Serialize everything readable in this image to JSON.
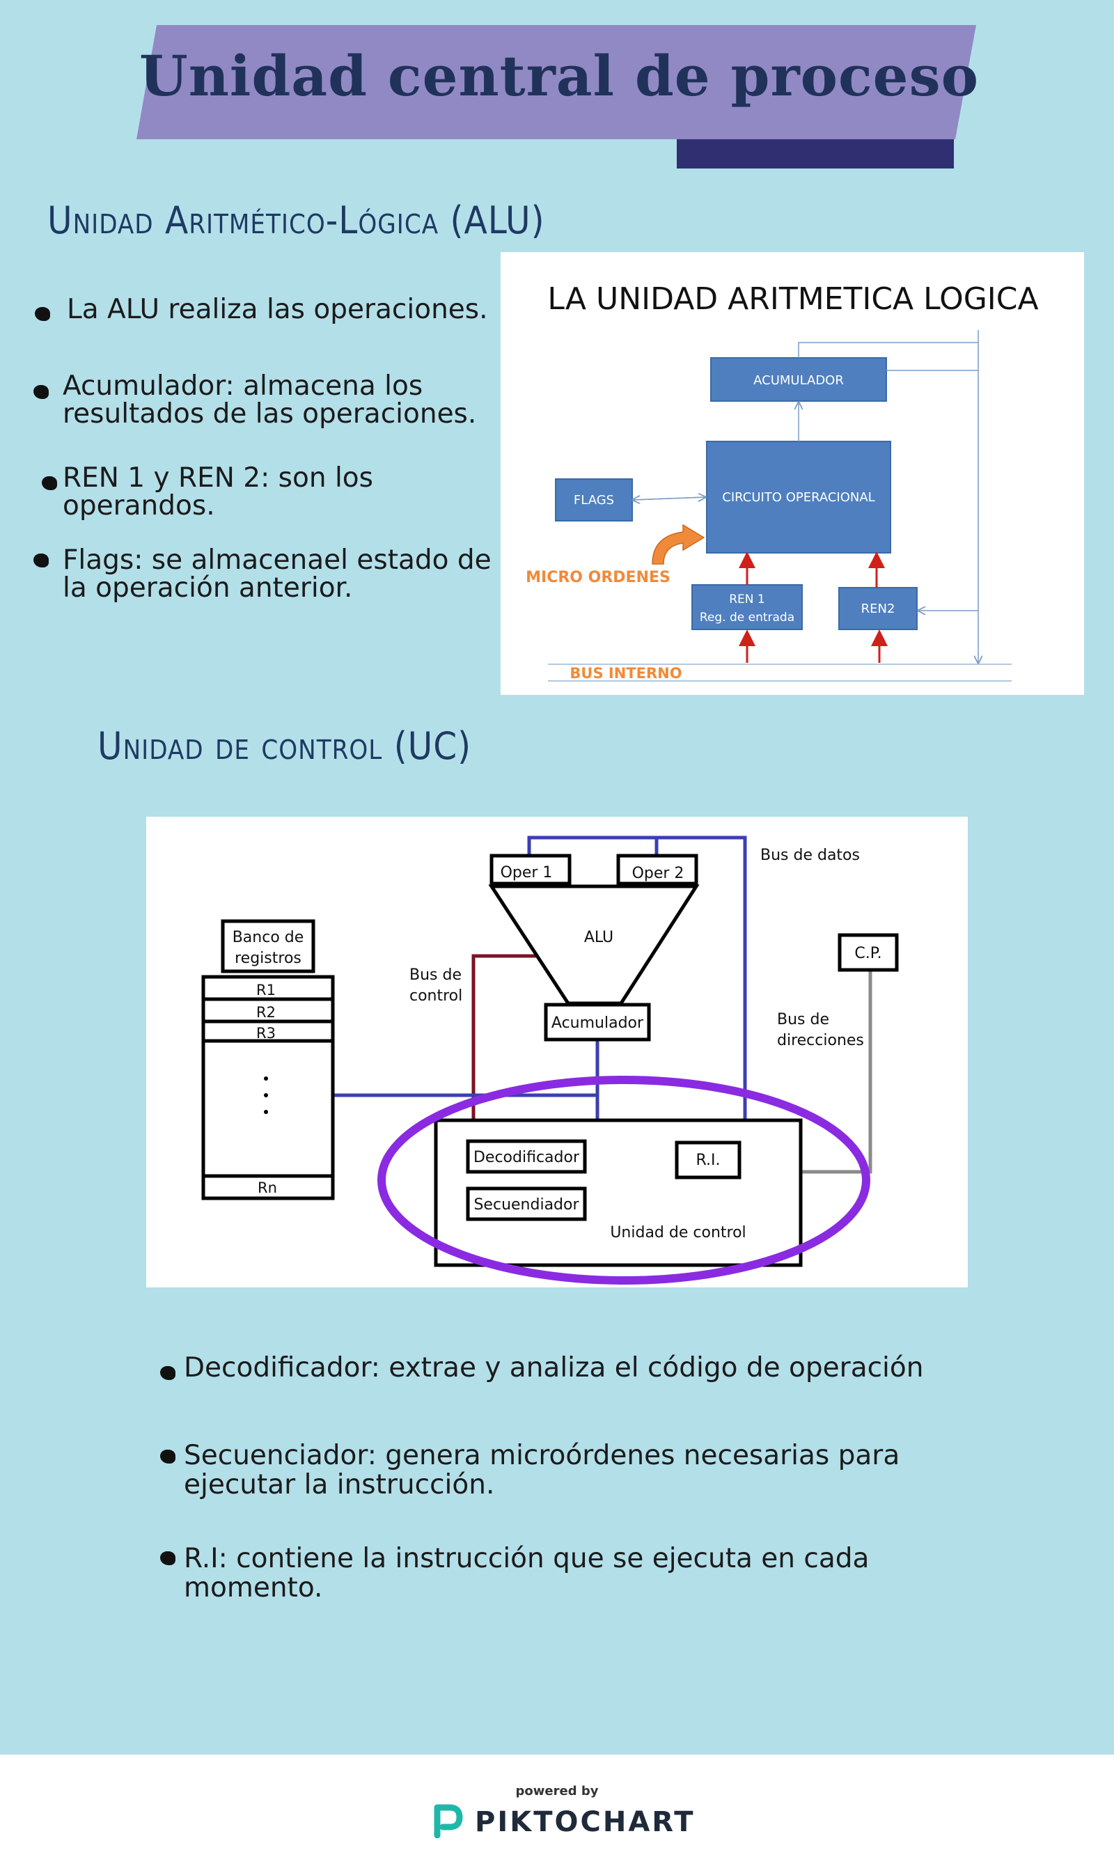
{
  "title": "Unidad central de proceso",
  "alu_section": {
    "heading": "Unidad Aritmético-Lógica (ALU)",
    "bullets": [
      "La ALU realiza las operaciones.",
      "Acumulador: almacena los",
      "resultados de las operaciones.",
      "REN 1 y REN 2: son los",
      "operandos.",
      "Flags: se almacenael estado de",
      "la operación anterior."
    ],
    "diagram": {
      "heading": "LA UNIDAD ARITMETICA LOGICA",
      "acumulador": "ACUMULADOR",
      "circuito": "CIRCUITO OPERACIONAL",
      "flags": "FLAGS",
      "micro": "MICRO ORDENES",
      "ren1_a": "REN 1",
      "ren1_b": "Reg.  de entrada",
      "ren2": "REN2",
      "bus": "BUS INTERNO"
    }
  },
  "uc_section": {
    "heading": "Unidad de control (UC)",
    "diagram": {
      "oper1": "Oper 1",
      "oper2": "Oper 2",
      "alu": "ALU",
      "acumulador": "Acumulador",
      "bus_datos": "Bus de datos",
      "bus_control_1": "Bus de",
      "bus_control_2": "control",
      "bus_dir_1": "Bus de",
      "bus_dir_2": "direcciones",
      "banco_1": "Banco de",
      "banco_2": "registros",
      "r1": "R1",
      "r2": "R2",
      "r3": "R3",
      "rn": "Rn",
      "cp": "C.P.",
      "decodificador": "Decodificador",
      "secuenciador": "Secuendiador",
      "ri": "R.I.",
      "unidad_control": "Unidad de control"
    },
    "bullets": [
      "Decodificador: extrae y analiza el código de operación",
      "Secuenciador: genera microórdenes necesarias para",
      "ejecutar la instrucción.",
      "R.I: contiene la instrucción que se ejecuta en cada",
      "momento."
    ]
  },
  "footer": {
    "powered": "powered by",
    "brand": "PIKTOCHART"
  }
}
